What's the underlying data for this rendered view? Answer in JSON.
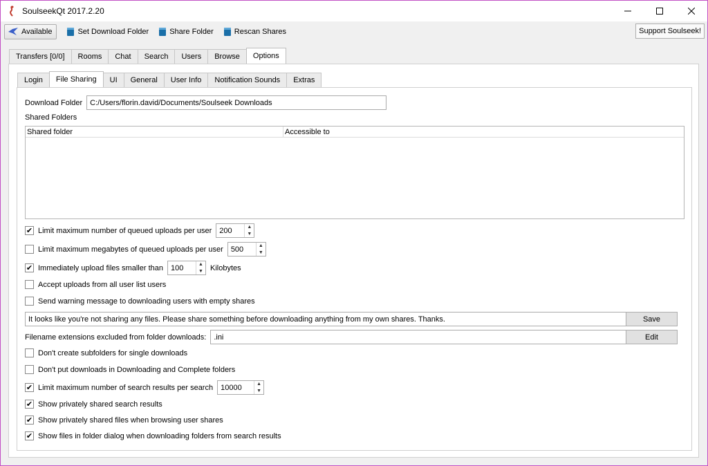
{
  "window": {
    "title": "SoulseekQt 2017.2.20"
  },
  "toolbar": {
    "available": "Available",
    "set_download_folder": "Set Download Folder",
    "share_folder": "Share Folder",
    "rescan_shares": "Rescan Shares",
    "support": "Support Soulseek!"
  },
  "tabs": {
    "main": [
      "Transfers [0/0]",
      "Rooms",
      "Chat",
      "Search",
      "Users",
      "Browse",
      "Options"
    ],
    "main_active": "Options",
    "sub": [
      "Login",
      "File Sharing",
      "UI",
      "General",
      "User Info",
      "Notification Sounds",
      "Extras"
    ],
    "sub_active": "File Sharing"
  },
  "file_sharing": {
    "download_folder_label": "Download Folder",
    "download_folder_value": "C:/Users/florin.david/Documents/Soulseek Downloads",
    "shared_folders_label": "Shared Folders",
    "table_columns": [
      "Shared folder",
      "Accessible to"
    ],
    "opt_limit_queued_uploads": "Limit maximum number of queued uploads per user",
    "opt_limit_queued_uploads_checked": true,
    "opt_limit_queued_uploads_value": "200",
    "opt_limit_megabytes": "Limit maximum megabytes of queued uploads per user",
    "opt_limit_megabytes_checked": false,
    "opt_limit_megabytes_value": "500",
    "opt_upload_smaller": "Immediately upload files smaller than",
    "opt_upload_smaller_checked": true,
    "opt_upload_smaller_value": "100",
    "opt_upload_smaller_unit": "Kilobytes",
    "opt_accept_uploads": "Accept uploads from all user list users",
    "opt_accept_uploads_checked": false,
    "opt_send_warning": "Send warning message to downloading users with empty shares",
    "opt_send_warning_checked": false,
    "warning_message": "It looks like you're not sharing any files. Please share something before downloading anything from my own shares. Thanks.",
    "save_button": "Save",
    "excluded_ext_label": "Filename extensions excluded from folder downloads:",
    "excluded_ext_value": ".ini",
    "edit_button": "Edit",
    "opt_no_subfolders": "Don't create subfolders for single downloads",
    "opt_no_subfolders_checked": false,
    "opt_no_put_downloads": "Don't put downloads in Downloading and Complete folders",
    "opt_no_put_downloads_checked": false,
    "opt_limit_search_results": "Limit maximum number of search results per search",
    "opt_limit_search_results_checked": true,
    "opt_limit_search_results_value": "10000",
    "opt_show_private_search": "Show privately shared search results",
    "opt_show_private_search_checked": true,
    "opt_show_private_browse": "Show privately shared files when browsing user shares",
    "opt_show_private_browse_checked": true,
    "opt_show_files_dialog": "Show files in folder dialog when downloading folders from search results",
    "opt_show_files_dialog_checked": true
  },
  "icons": {
    "app": "soulseek-bird-icon",
    "available": "bird-icon",
    "folder_buttons": "bucket-icon"
  },
  "colors": {
    "window_border": "#c14ec4",
    "panel": "#ffffff",
    "chrome": "#f0f0f0"
  }
}
